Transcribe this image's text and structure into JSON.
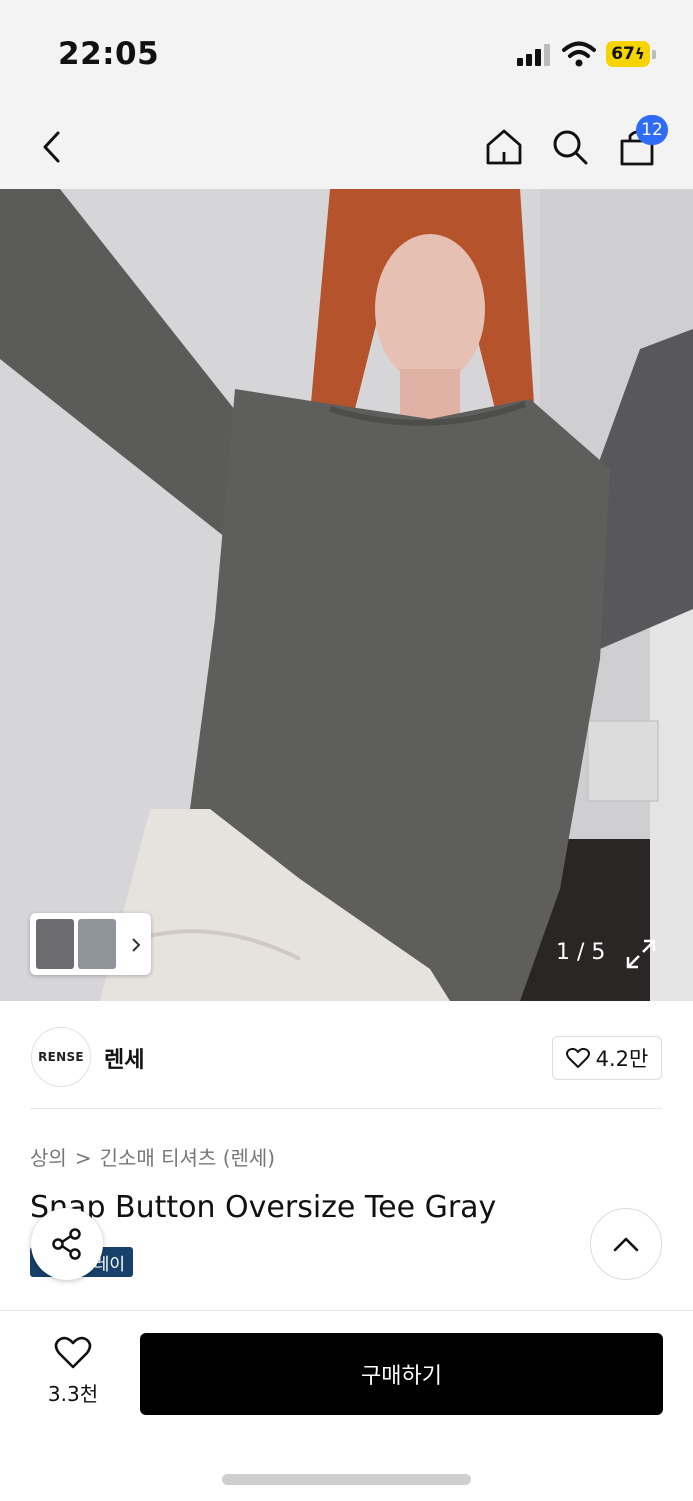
{
  "status_bar": {
    "time": "22:05",
    "battery": "67",
    "icons": [
      "cellular-signal-icon",
      "wifi-icon",
      "battery-charging-icon"
    ]
  },
  "nav": {
    "icons": [
      "back-chevron-icon",
      "home-icon",
      "search-icon",
      "cart-bag-icon"
    ],
    "cart_count": "12"
  },
  "gallery": {
    "counter": "1 / 5",
    "icons": [
      "expand-arrows-icon",
      "chevron-right-icon"
    ]
  },
  "brand": {
    "logo_text": "RENSE",
    "name": "렌세",
    "likes": "4.2만"
  },
  "breadcrumb": {
    "category": "상의",
    "separator": ">",
    "subcategory": "긴소매 티셔츠 (렌세)"
  },
  "product": {
    "title": "Snap Button Oversize Tee Gray",
    "tag": "레이"
  },
  "bottom": {
    "wish_count": "3.3천",
    "buy_label": "구매하기"
  },
  "colors": {
    "accent_blue": "#2f6cf6",
    "battery_yellow": "#f5d400",
    "tag_navy": "#17406a",
    "buy_button": "#000000"
  }
}
